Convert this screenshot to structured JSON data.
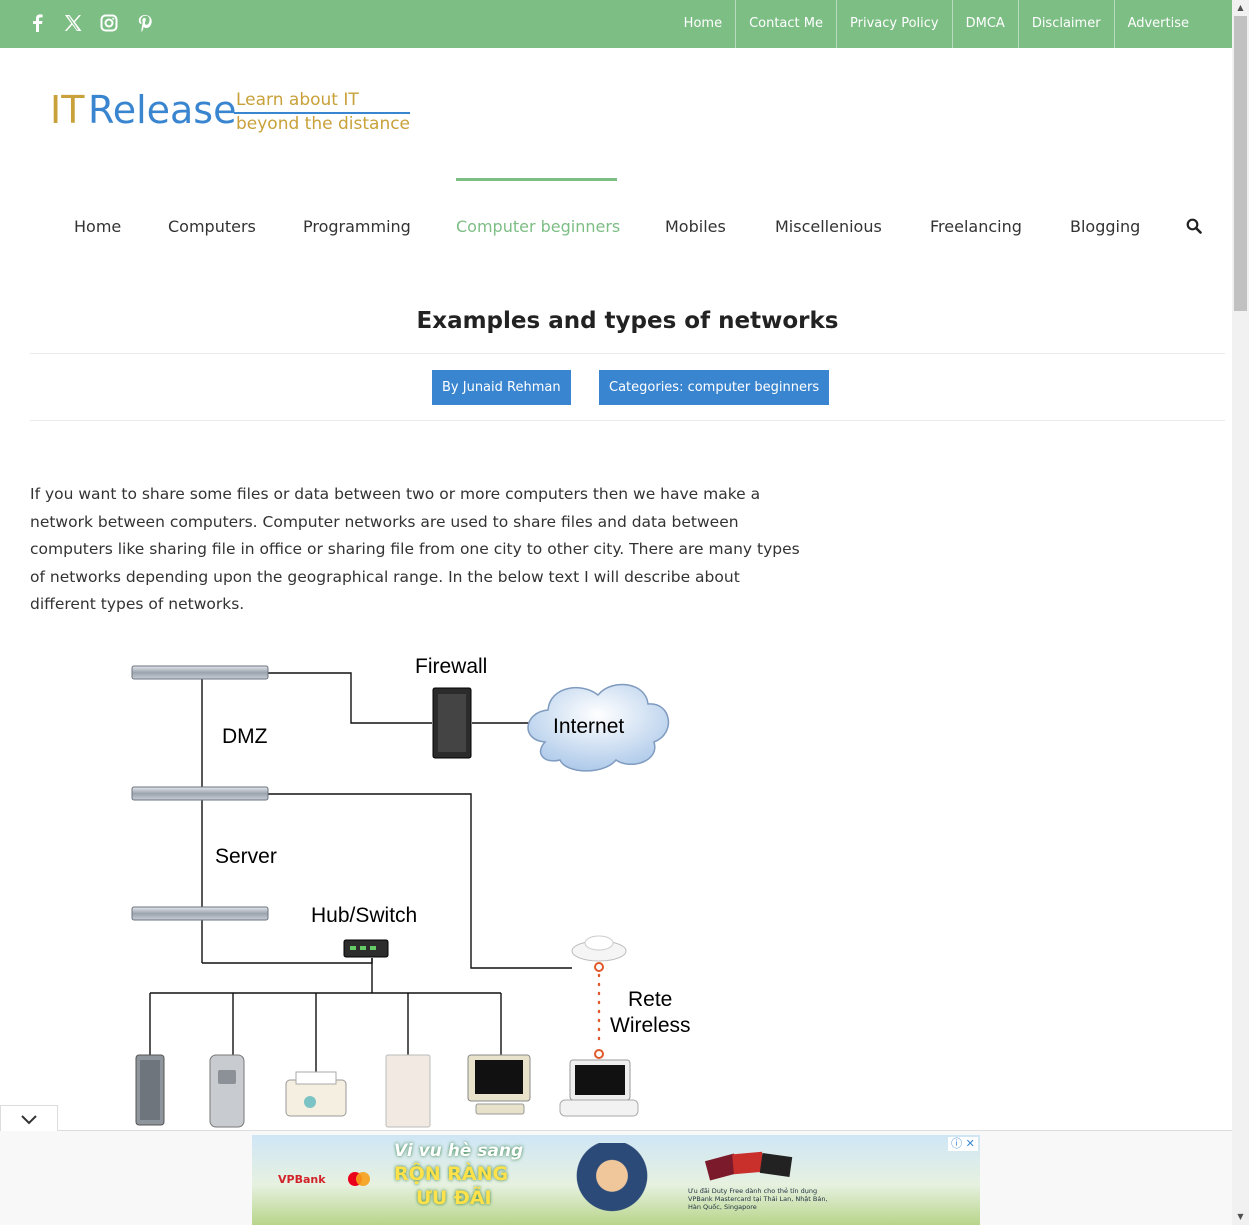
{
  "topbar": {
    "social": [
      "facebook-icon",
      "x-twitter-icon",
      "instagram-icon",
      "pinterest-icon"
    ],
    "links": [
      "Home",
      "Contact Me",
      "Privacy Policy",
      "DMCA",
      "Disclaimer",
      "Advertise"
    ],
    "bg_color": "#7dbe85"
  },
  "logo": {
    "it": "IT",
    "release": "Release",
    "tagline_1": "Learn about IT",
    "tagline_2": "beyond the distance"
  },
  "mainnav": {
    "items": [
      "Home",
      "Computers",
      "Programming",
      "Computer beginners",
      "Mobiles",
      "Miscellenious",
      "Freelancing",
      "Blogging"
    ],
    "active": "Computer beginners",
    "search_icon": "search-icon"
  },
  "post": {
    "title": "Examples and types of networks",
    "author": "By Junaid Rehman",
    "categories": "Categories: computer beginners",
    "intro": "If you want to share some files or data between two or more computers then we have make a network between computers. Computer networks are used to share files and data between computers like sharing file in office or sharing file from one city to other city. There are many types of networks depending upon the geographical range. In the below text I will describe about different types of networks."
  },
  "diagram": {
    "labels": {
      "firewall": "Firewall",
      "internet": "Internet",
      "dmz": "DMZ",
      "server": "Server",
      "hub_switch": "Hub/Switch",
      "rete": "Rete",
      "wireless": "Wireless"
    }
  },
  "ad": {
    "headline_1": "Vi vu hè sang",
    "headline_2": "RỘN RÀNG",
    "headline_3": "ƯU ĐÃI",
    "brand": "VPBank",
    "fine_print": "Ưu đãi Duty Free dành cho thẻ tín dụng VPBank Mastercard tại Thái Lan, Nhật Bản, Hàn Quốc, Singapore",
    "close_label": "ⓘ ✕"
  },
  "colors": {
    "accent_green": "#7dbe85",
    "accent_blue": "#3a85d0",
    "logo_gold": "#c9a13a"
  }
}
